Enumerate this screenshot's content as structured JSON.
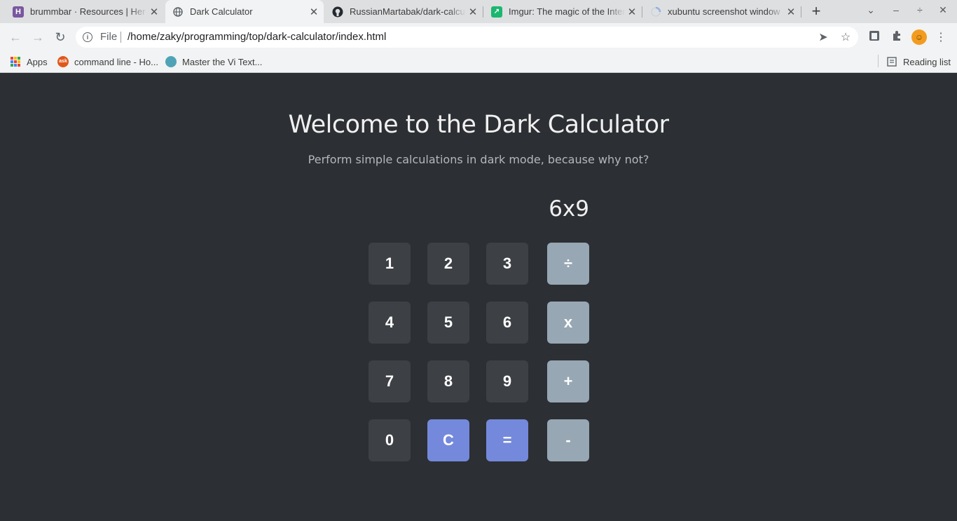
{
  "browser": {
    "tabs": [
      {
        "title": "brummbar · Resources | Her",
        "favicon": "heroku-icon",
        "active": false
      },
      {
        "title": "Dark Calculator",
        "favicon": "globe-icon",
        "active": true
      },
      {
        "title": "RussianMartabak/dark-calcul",
        "favicon": "github-icon",
        "active": false
      },
      {
        "title": "Imgur: The magic of the Inter",
        "favicon": "imgur-icon",
        "active": false
      },
      {
        "title": "xubuntu screenshot window",
        "favicon": "loading-spinner-icon",
        "active": false
      }
    ],
    "new_tab": "+",
    "window_controls": {
      "dropdown": "⌄",
      "minimize": "–",
      "maximize": "÷",
      "close": "✕"
    },
    "omnibox": {
      "scheme": "File",
      "url": "/home/zaky/programming/top/dark-calculator/index.html"
    },
    "bookmarks": [
      {
        "label": "Apps",
        "icon": "apps-grid-icon"
      },
      {
        "label": "command line - Ho...",
        "icon": "ask-ubuntu-icon"
      },
      {
        "label": "Master the Vi Text...",
        "icon": "vi-icon"
      }
    ],
    "reading_list": "Reading list",
    "colors": {
      "tab_strip": "#dedfe1",
      "toolbar": "#f1f3f4",
      "avatar": "#f29c1f"
    }
  },
  "page": {
    "title": "Welcome to the Dark Calculator",
    "subtitle": "Perform simple calculations in dark mode, because why not?",
    "display": "6x9",
    "keys": [
      {
        "label": "1",
        "kind": "num"
      },
      {
        "label": "2",
        "kind": "num"
      },
      {
        "label": "3",
        "kind": "num"
      },
      {
        "label": "÷",
        "kind": "op"
      },
      {
        "label": "4",
        "kind": "num"
      },
      {
        "label": "5",
        "kind": "num"
      },
      {
        "label": "6",
        "kind": "num"
      },
      {
        "label": "x",
        "kind": "op"
      },
      {
        "label": "7",
        "kind": "num"
      },
      {
        "label": "8",
        "kind": "num"
      },
      {
        "label": "9",
        "kind": "num"
      },
      {
        "label": "+",
        "kind": "op"
      },
      {
        "label": "0",
        "kind": "num"
      },
      {
        "label": "C",
        "kind": "action"
      },
      {
        "label": "=",
        "kind": "action"
      },
      {
        "label": "-",
        "kind": "op"
      }
    ],
    "colors": {
      "background": "#2c2f33",
      "number_key": "#3d4045",
      "operator_key": "#97a7b4",
      "action_key": "#7489dc"
    }
  }
}
